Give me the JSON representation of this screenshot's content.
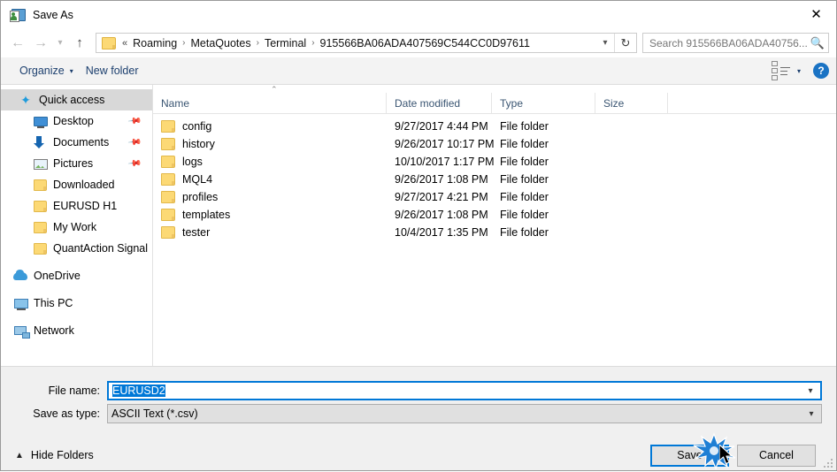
{
  "window": {
    "title": "Save As",
    "title_icon": "save-as-icon",
    "close_icon": "close-icon"
  },
  "nav": {
    "back_icon": "arrow-left-icon",
    "forward_icon": "arrow-right-icon",
    "recent_icon": "chevron-down-icon",
    "up_icon": "arrow-up-icon",
    "breadcrumb_folder_icon": "folder-icon",
    "breadcrumb_prefix": "«",
    "breadcrumb": [
      "Roaming",
      "MetaQuotes",
      "Terminal",
      "915566BA06ADA407569C544CC0D97611"
    ],
    "breadcrumb_separator": "›",
    "dropdown_icon": "chevron-down-icon",
    "refresh_icon": "refresh-icon",
    "search_placeholder": "Search 915566BA06ADA40756...",
    "search_icon": "search-icon"
  },
  "toolbar": {
    "organize_label": "Organize",
    "organize_caret": "▾",
    "new_folder_label": "New folder",
    "view_icon": "view-list-icon",
    "view_caret": "▾",
    "help_label": "?",
    "help_icon": "help-icon"
  },
  "sidebar": {
    "items": [
      {
        "label": "Quick access",
        "icon": "star-icon",
        "level": 1,
        "selected": true,
        "pinned": false
      },
      {
        "label": "Desktop",
        "icon": "monitor-icon",
        "level": 2,
        "selected": false,
        "pinned": true
      },
      {
        "label": "Documents",
        "icon": "download-icon",
        "level": 2,
        "selected": false,
        "pinned": true
      },
      {
        "label": "Pictures",
        "icon": "picture-icon",
        "level": 2,
        "selected": false,
        "pinned": true
      },
      {
        "label": "Downloaded",
        "icon": "folder-icon",
        "level": 2,
        "selected": false,
        "pinned": false
      },
      {
        "label": "EURUSD H1",
        "icon": "folder-icon",
        "level": 2,
        "selected": false,
        "pinned": false
      },
      {
        "label": "My Work",
        "icon": "folder-icon",
        "level": 2,
        "selected": false,
        "pinned": false
      },
      {
        "label": "QuantAction Signal",
        "icon": "folder-icon",
        "level": 2,
        "selected": false,
        "pinned": false
      },
      {
        "label": "OneDrive",
        "icon": "cloud-icon",
        "level": 0,
        "selected": false,
        "pinned": false
      },
      {
        "label": "This PC",
        "icon": "computer-icon",
        "level": 0,
        "selected": false,
        "pinned": false
      },
      {
        "label": "Network",
        "icon": "network-icon",
        "level": 0,
        "selected": false,
        "pinned": false
      }
    ]
  },
  "filelist": {
    "sort_indicator": "⌃",
    "columns": [
      "Name",
      "Date modified",
      "Type",
      "Size"
    ],
    "rows": [
      {
        "name": "config",
        "date": "9/27/2017 4:44 PM",
        "type": "File folder",
        "size": ""
      },
      {
        "name": "history",
        "date": "9/26/2017 10:17 PM",
        "type": "File folder",
        "size": ""
      },
      {
        "name": "logs",
        "date": "10/10/2017 1:17 PM",
        "type": "File folder",
        "size": ""
      },
      {
        "name": "MQL4",
        "date": "9/26/2017 1:08 PM",
        "type": "File folder",
        "size": ""
      },
      {
        "name": "profiles",
        "date": "9/27/2017 4:21 PM",
        "type": "File folder",
        "size": ""
      },
      {
        "name": "templates",
        "date": "9/26/2017 1:08 PM",
        "type": "File folder",
        "size": ""
      },
      {
        "name": "tester",
        "date": "10/4/2017 1:35 PM",
        "type": "File folder",
        "size": ""
      }
    ]
  },
  "form": {
    "filename_label": "File name:",
    "filename_value": "EURUSD2",
    "filename_selected": true,
    "filetype_label": "Save as type:",
    "filetype_value": "ASCII Text (*.csv)",
    "caret_icon": "chevron-down-icon"
  },
  "footer": {
    "hide_folders_label": "Hide Folders",
    "hide_folders_icon": "chevron-up-icon",
    "save_label": "Save",
    "cancel_label": "Cancel",
    "resize_grip_icon": "resize-grip-icon"
  },
  "overlay": {
    "click_burst_icon": "click-burst-icon",
    "cursor_icon": "mouse-cursor-icon",
    "accent_color": "#0078d7",
    "burst_color": "#1e7fd4"
  }
}
